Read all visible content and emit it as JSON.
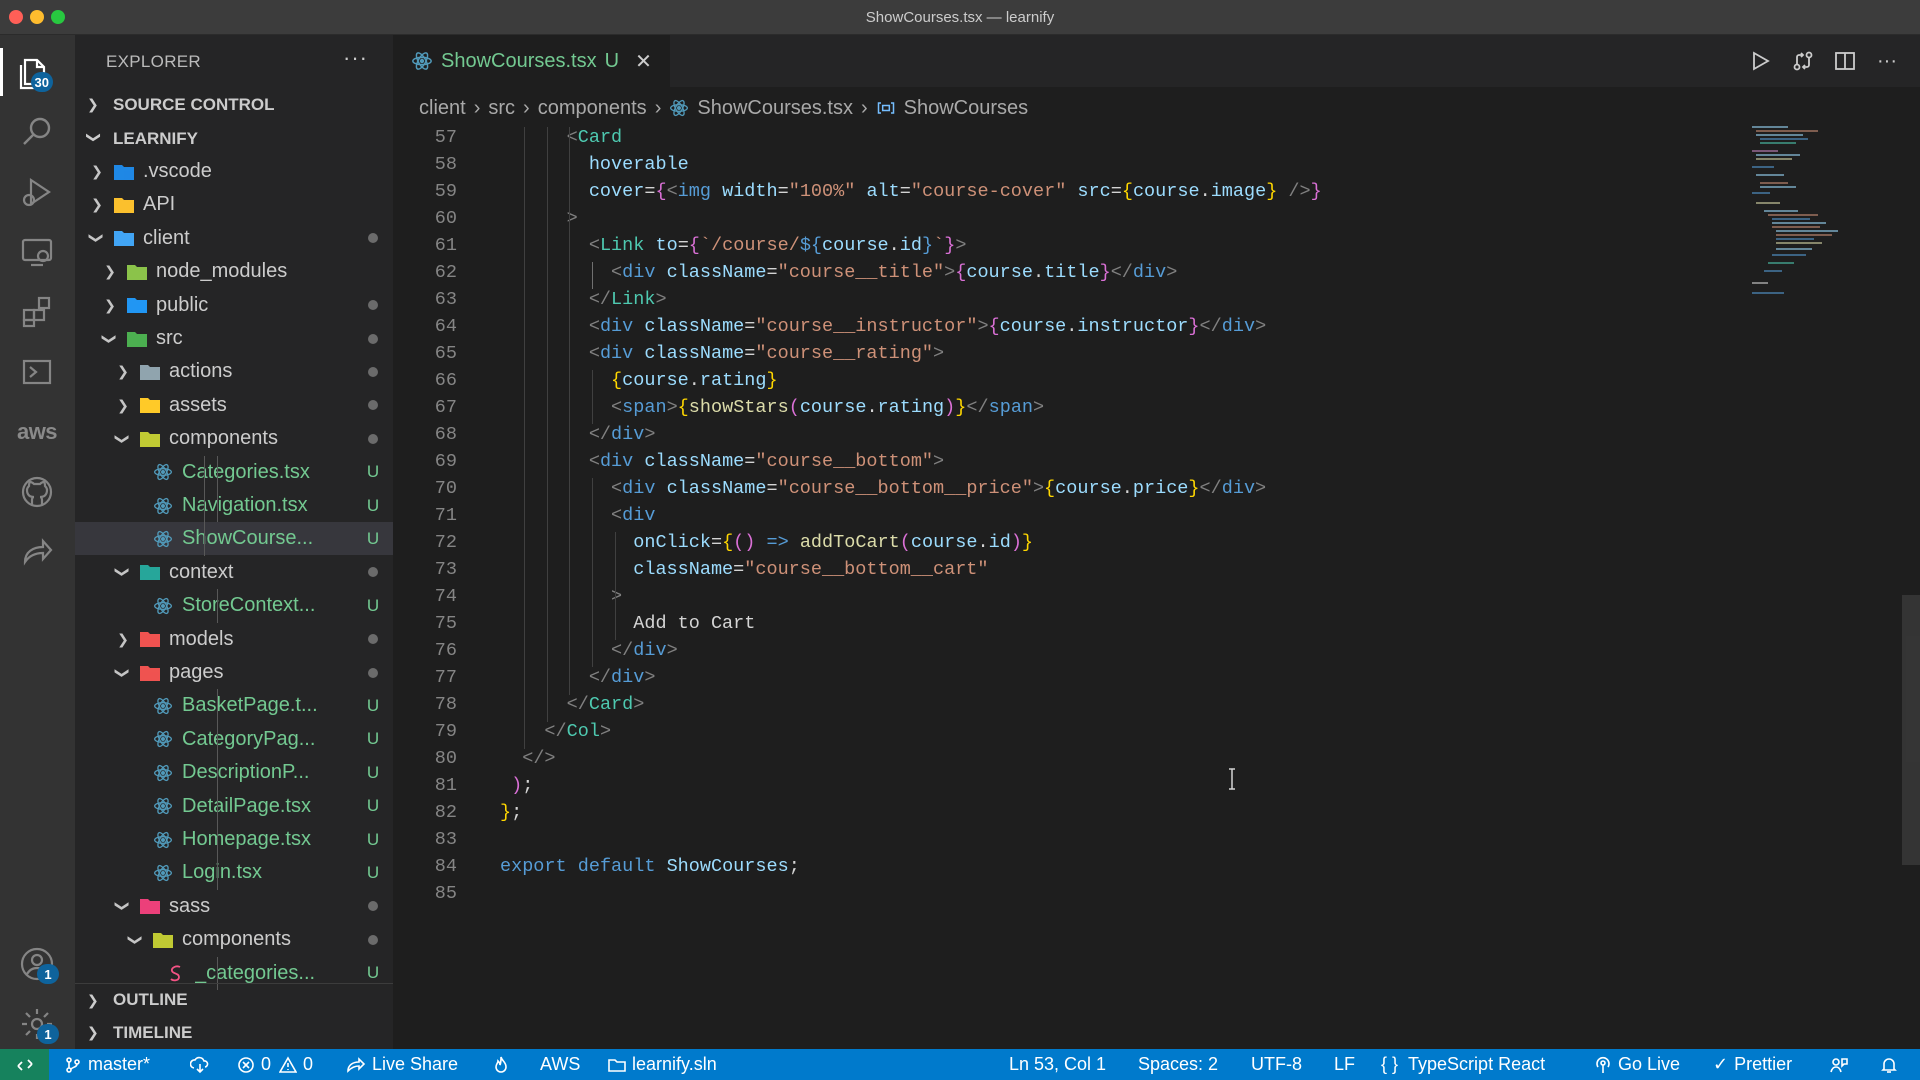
{
  "window": {
    "title": "ShowCourses.tsx — learnify"
  },
  "activity_bar": {
    "explorer_badge": "30",
    "accounts_badge": "1",
    "settings_badge": "1",
    "aws_label": "aws"
  },
  "sidebar": {
    "title": "EXPLORER",
    "more": "···",
    "source_control": "SOURCE CONTROL",
    "project": "LEARNIFY",
    "outline": "OUTLINE",
    "timeline": "TIMELINE",
    "tree": [
      {
        "name": ".vscode",
        "status": ""
      },
      {
        "name": "API",
        "status": ""
      },
      {
        "name": "client",
        "status": "dot"
      },
      {
        "name": "node_modules",
        "status": ""
      },
      {
        "name": "public",
        "status": "dot"
      },
      {
        "name": "src",
        "status": "dot"
      },
      {
        "name": "actions",
        "status": "dot"
      },
      {
        "name": "assets",
        "status": "dot"
      },
      {
        "name": "components",
        "status": "dot"
      },
      {
        "name": "Categories.tsx",
        "status": "U"
      },
      {
        "name": "Navigation.tsx",
        "status": "U"
      },
      {
        "name": "ShowCourse...",
        "status": "U"
      },
      {
        "name": "context",
        "status": "dot"
      },
      {
        "name": "StoreContext...",
        "status": "U"
      },
      {
        "name": "models",
        "status": "dot"
      },
      {
        "name": "pages",
        "status": "dot"
      },
      {
        "name": "BasketPage.t...",
        "status": "U"
      },
      {
        "name": "CategoryPag...",
        "status": "U"
      },
      {
        "name": "DescriptionP...",
        "status": "U"
      },
      {
        "name": "DetailPage.tsx",
        "status": "U"
      },
      {
        "name": "Homepage.tsx",
        "status": "U"
      },
      {
        "name": "Login.tsx",
        "status": "U"
      },
      {
        "name": "sass",
        "status": "dot"
      },
      {
        "name": "components",
        "status": "dot"
      },
      {
        "name": "_categories...",
        "status": "U"
      }
    ]
  },
  "editor": {
    "tab": {
      "label": "ShowCourses.tsx",
      "status": "U",
      "close": "✕"
    },
    "breadcrumb": [
      "client",
      "src",
      "components",
      "ShowCourses.tsx",
      "ShowCourses"
    ],
    "line_numbers": [
      "57",
      "58",
      "59",
      "60",
      "61",
      "62",
      "63",
      "64",
      "65",
      "66",
      "67",
      "68",
      "69",
      "70",
      "71",
      "72",
      "73",
      "74",
      "75",
      "76",
      "77",
      "78",
      "79",
      "80",
      "81",
      "82",
      "83",
      "84",
      "85"
    ]
  },
  "status_bar": {
    "branch": "master*",
    "errors": "0",
    "warnings": "0",
    "live_share": "Live Share",
    "aws": "AWS",
    "solution": "learnify.sln",
    "position": "Ln 53, Col 1",
    "spaces": "Spaces: 2",
    "encoding": "UTF-8",
    "eol": "LF",
    "language": "TypeScript React",
    "go_live": "Go Live",
    "prettier": "Prettier"
  },
  "colors": {
    "accent": "#007acc",
    "remote": "#16825d",
    "untracked": "#73c991",
    "react_icon": "#519aba"
  }
}
